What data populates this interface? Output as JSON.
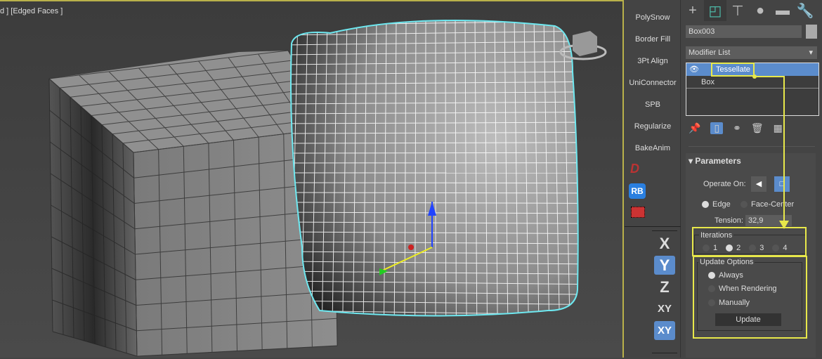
{
  "viewport": {
    "label": "d ] [Edged Faces ]"
  },
  "toolbar": {
    "buttons": [
      "PolySnow",
      "Border Fill",
      "3Pt Align",
      "UniConnector",
      "SPB",
      "Regularize",
      "BakeAnim"
    ],
    "icons": [
      "d-script-icon",
      "rb-icon",
      "grid-select-icon"
    ],
    "rb_label": "RB"
  },
  "axis": {
    "items": [
      "X",
      "Y",
      "Z",
      "XY",
      "XY"
    ],
    "active": [
      "Y",
      "XY"
    ]
  },
  "panel": {
    "tabs": [
      "create-icon",
      "modify-icon",
      "hierarchy-icon",
      "motion-icon",
      "display-icon",
      "utilities-icon"
    ],
    "object_name": "Box003",
    "modifier_list": "Modifier List",
    "stack": [
      "Tessellate",
      "Box"
    ],
    "params_title": "Parameters",
    "operate_on": "Operate On:",
    "edge": "Edge",
    "face_center": "Face-Center",
    "tension_label": "Tension:",
    "tension": "32,9",
    "iterations_title": "Iterations",
    "iterations": [
      "1",
      "2",
      "3",
      "4"
    ],
    "iterations_selected": "2",
    "update_title": "Update Options",
    "update_options": [
      "Always",
      "When Rendering",
      "Manually"
    ],
    "update_selected": "Always",
    "update_button": "Update"
  },
  "colors": {
    "highlight": "#e8e84a",
    "selection": "#5b8ccc",
    "object_outline": "#6ee8f0"
  }
}
